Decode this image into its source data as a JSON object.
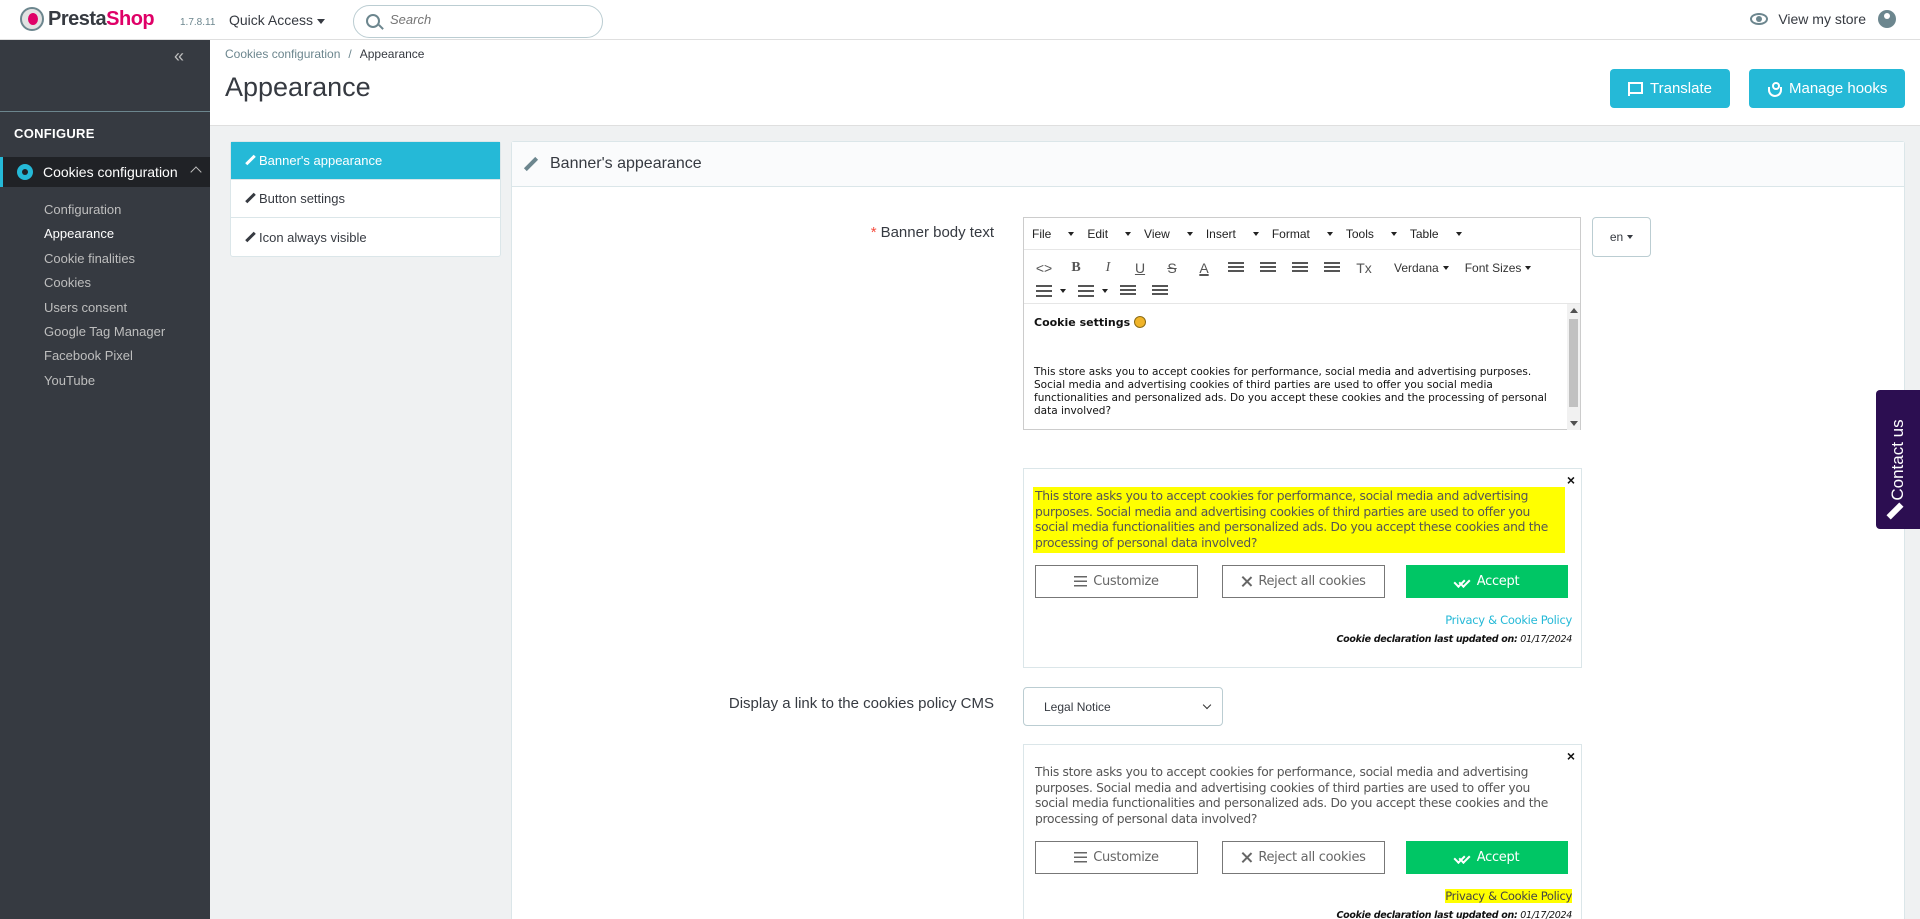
{
  "header": {
    "logo_presta": "Presta",
    "logo_shop": "Shop",
    "version": "1.7.8.11",
    "quick_access": "Quick Access",
    "search_placeholder": "Search",
    "view_store": "View my store"
  },
  "sidebar": {
    "collapse_glyph": "«",
    "section": "CONFIGURE",
    "active_item": "Cookies configuration",
    "sub_items": [
      "Configuration",
      "Appearance",
      "Cookie finalities",
      "Cookies",
      "Users consent",
      "Google Tag Manager",
      "Facebook Pixel",
      "YouTube"
    ],
    "current_sub": "Appearance"
  },
  "page": {
    "breadcrumb_parent": "Cookies configuration",
    "breadcrumb_sep": "/",
    "breadcrumb_current": "Appearance",
    "title": "Appearance",
    "translate_label": "Translate",
    "manage_hooks_label": "Manage hooks"
  },
  "tabs": [
    {
      "label": "Banner's appearance",
      "active": true
    },
    {
      "label": "Button settings",
      "active": false
    },
    {
      "label": "Icon always visible",
      "active": false
    }
  ],
  "panel": {
    "title": "Banner's appearance",
    "body_text_label": "Banner body text",
    "required_marker": "*",
    "lang": "en",
    "editor": {
      "menus": [
        "File",
        "Edit",
        "View",
        "Insert",
        "Format",
        "Tools",
        "Table"
      ],
      "code_glyph": "<>",
      "bold": "B",
      "italic": "I",
      "underline": "U",
      "strike": "S",
      "fontcolor": "A",
      "clear_format": "Tx",
      "font": "Verdana",
      "font_sizes": "Font Sizes",
      "content_heading": "Cookie settings",
      "content_body": "This store asks you to accept cookies for performance, social media and advertising purposes. Social media and advertising cookies of third parties are used to offer you social media functionalities and personalized ads. Do you accept these cookies and the processing of personal data involved?"
    },
    "cms_link_label": "Display a link to the cookies policy CMS",
    "cms_select_value": "Legal Notice",
    "preview": {
      "close": "×",
      "text": "This store asks you to accept cookies for performance, social media and advertising purposes. Social media and advertising cookies of third parties are used to offer you social media functionalities and personalized ads. Do you accept these cookies and the processing of personal data involved?",
      "customize": "Customize",
      "reject": "Reject all cookies",
      "accept": "Accept",
      "policy": "Privacy & Cookie Policy",
      "declared_label": "Cookie declaration last updated on:",
      "declared_date": "01/17/2024"
    }
  },
  "contact_tab": "Contact us",
  "colors": {
    "accent": "#25b9d7",
    "sidebar_bg": "#363a41",
    "accept_green": "#00c665",
    "highlight": "#ffff00",
    "contact_bg": "#2c0e51"
  }
}
